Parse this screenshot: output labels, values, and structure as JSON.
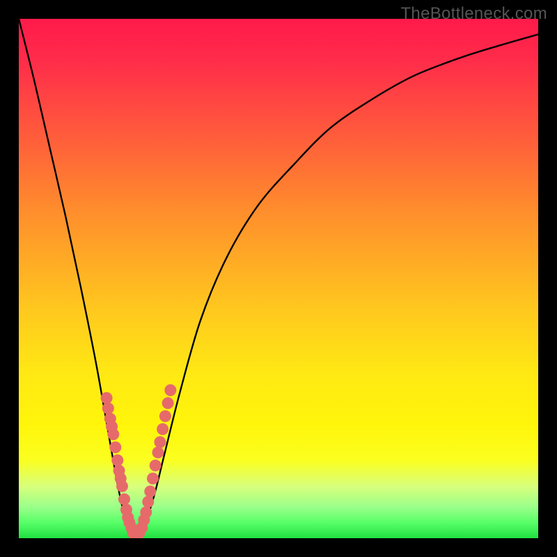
{
  "watermark": "TheBottleneck.com",
  "chart_data": {
    "type": "line",
    "title": "",
    "xlabel": "",
    "ylabel": "",
    "xlim": [
      0,
      100
    ],
    "ylim": [
      0,
      100
    ],
    "series": [
      {
        "name": "bottleneck-curve",
        "x": [
          0,
          3,
          6,
          9,
          12,
          15,
          18,
          19.5,
          21,
          22.5,
          24,
          26,
          28,
          31,
          35,
          40,
          46,
          53,
          60,
          68,
          76,
          85,
          93,
          100
        ],
        "y": [
          100,
          88,
          75,
          62,
          48,
          33,
          16,
          8,
          2,
          0,
          2,
          8,
          16,
          28,
          42,
          54,
          64,
          72,
          79,
          84.5,
          89,
          92.5,
          95,
          97
        ]
      }
    ],
    "annotations": {
      "dot_clusters": [
        {
          "name": "left-branch-dots",
          "points": [
            [
              16.9,
              27.0
            ],
            [
              17.2,
              25.0
            ],
            [
              17.6,
              23.0
            ],
            [
              17.9,
              21.5
            ],
            [
              18.2,
              20.0
            ],
            [
              18.6,
              17.5
            ],
            [
              19.0,
              15.0
            ],
            [
              19.3,
              13.0
            ],
            [
              19.6,
              11.5
            ],
            [
              19.9,
              10.0
            ],
            [
              20.3,
              7.5
            ],
            [
              20.7,
              5.5
            ],
            [
              21.0,
              4.0
            ],
            [
              21.3,
              3.0
            ],
            [
              21.7,
              2.0
            ]
          ]
        },
        {
          "name": "right-branch-dots",
          "points": [
            [
              23.7,
              2.0
            ],
            [
              24.1,
              3.5
            ],
            [
              24.5,
              5.0
            ],
            [
              24.9,
              7.0
            ],
            [
              25.3,
              9.0
            ],
            [
              25.8,
              11.5
            ],
            [
              26.3,
              14.0
            ],
            [
              26.8,
              16.5
            ],
            [
              27.2,
              18.5
            ],
            [
              27.7,
              21.0
            ],
            [
              28.2,
              23.5
            ],
            [
              28.7,
              26.0
            ],
            [
              29.2,
              28.5
            ]
          ]
        },
        {
          "name": "valley-dots",
          "points": [
            [
              22.0,
              1.0
            ],
            [
              22.4,
              0.5
            ],
            [
              22.8,
              0.5
            ],
            [
              23.2,
              1.0
            ]
          ]
        }
      ]
    },
    "colors": {
      "curve": "#000000",
      "dots": "#e66a6a",
      "gradient_top": "#ff1a4a",
      "gradient_bottom": "#20e040",
      "frame": "#000000"
    }
  }
}
